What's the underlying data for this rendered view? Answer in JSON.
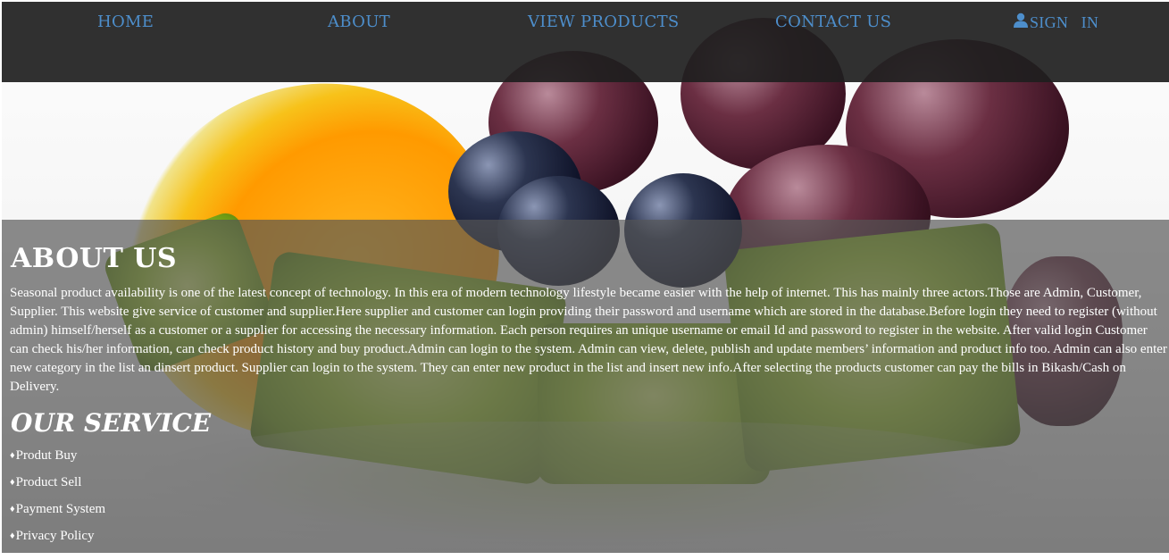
{
  "nav": {
    "home": "HOME",
    "about": "ABOUT",
    "view_products": "VIEW PRODUCTS",
    "contact_us": "CONTACT US",
    "sign_in": "SIGN   IN",
    "sign_in_icon": "user-icon",
    "link_color": "#4d8ecb"
  },
  "about": {
    "title": "ABOUT US",
    "text": "Seasonal product availability is one of the latest concept of technology. In this era of modern technology lifestyle became easier with the help of internet. This has mainly three actors.Those are Admin, Customer, Supplier. This website give service of customer and supplier.Here supplier and customer can login providing their password and username which are stored in the database.Before login they need to register (without admin) himself/herself as a customer or a supplier for accessing the necessary information. Each person requires an unique username or email Id and password to register in the website. After valid login Customer can check his/her information, can check product history and buy product.Admin can login to the system. Admin can view, delete, publish and update members’ information and product info too. Admin can also enter new category in the list an dinsert product. Supplier can login to the system. They can enter new product in the list and insert new info.After selecting the products customer can pay the bills in Bikash/Cash on Delivery."
  },
  "service": {
    "title": "OUR SERVICE",
    "bullet": "♦",
    "items": [
      "Produt Buy",
      "Product Sell",
      "Payment System",
      "Privacy Policy"
    ]
  }
}
